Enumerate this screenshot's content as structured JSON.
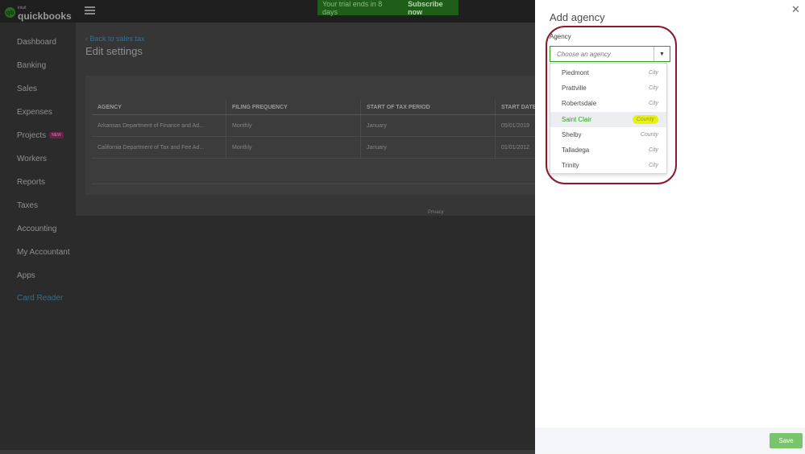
{
  "app": {
    "logo_intuit": "intuit",
    "logo_name": "quickbooks",
    "trial_text": "Your trial ends in 8 days",
    "subscribe_label": "Subscribe now"
  },
  "sidebar": {
    "items": [
      {
        "label": "Dashboard"
      },
      {
        "label": "Banking"
      },
      {
        "label": "Sales"
      },
      {
        "label": "Expenses"
      },
      {
        "label": "Projects",
        "badge": "NEW"
      },
      {
        "label": "Workers"
      },
      {
        "label": "Reports"
      },
      {
        "label": "Taxes"
      },
      {
        "label": "Accounting"
      },
      {
        "label": "My Accountant"
      },
      {
        "label": "Apps"
      },
      {
        "label": "Card Reader"
      }
    ]
  },
  "main": {
    "back_link": "Back to sales tax",
    "title": "Edit settings",
    "table": {
      "headers": [
        "AGENCY",
        "FILING FREQUENCY",
        "START OF TAX PERIOD",
        "START DATE"
      ],
      "rows": [
        [
          "Arkansas Department of Finance and Ad...",
          "Monthly",
          "January",
          "05/01/2019"
        ],
        [
          "California Department of Tax and Fee Ad...",
          "Monthly",
          "January",
          "01/01/2012"
        ]
      ]
    },
    "privacy": "Privacy"
  },
  "drawer": {
    "title": "Add agency",
    "field_label": "Agency",
    "placeholder": "Choose an agency",
    "options": [
      {
        "name": "Piedmont",
        "type": "City"
      },
      {
        "name": "Prattville",
        "type": "City"
      },
      {
        "name": "Robertsdale",
        "type": "City"
      },
      {
        "name": "Saint Clair",
        "type": "County",
        "selected": true
      },
      {
        "name": "Shelby",
        "type": "County"
      },
      {
        "name": "Talladega",
        "type": "City"
      },
      {
        "name": "Trinity",
        "type": "City"
      }
    ],
    "save_label": "Save"
  },
  "colors": {
    "accent_green": "#2ca01c",
    "highlight_yellow": "#e9f20f",
    "annotation_ring": "#8b1a2c"
  }
}
